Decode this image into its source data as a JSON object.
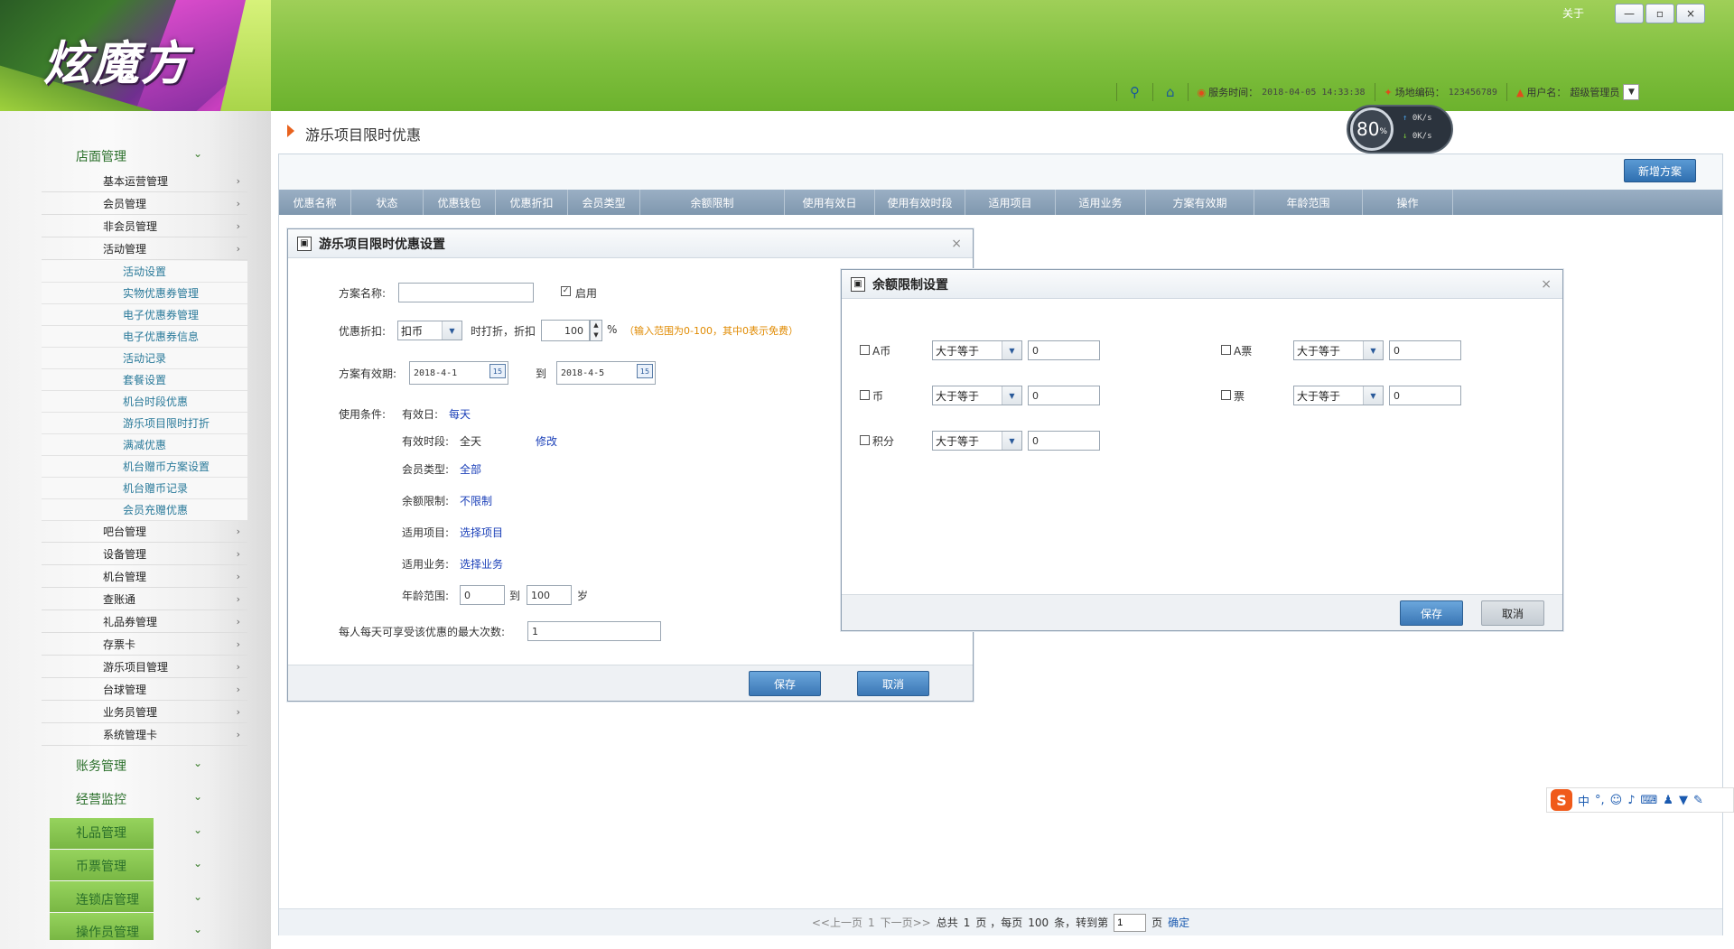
{
  "app": {
    "logo_text": "炫魔方",
    "about": "关于",
    "window_buttons": [
      "—",
      "▫",
      "×"
    ]
  },
  "topbar": {
    "service_time_label": "服务时间：",
    "service_time": "2018-04-05 14:33:38",
    "site_code_label": "场地编码：",
    "site_code": "123456789",
    "username_label": "用户名：",
    "username": "超级管理员"
  },
  "gauge": {
    "value": "80",
    "unit": "%",
    "up": "0K/s",
    "down": "0K/s"
  },
  "sidebar": {
    "groups": [
      {
        "label": "店面管理"
      },
      {
        "label": "账务管理"
      },
      {
        "label": "经营监控"
      },
      {
        "label": "礼品管理"
      },
      {
        "label": "币票管理"
      },
      {
        "label": "连锁店管理"
      },
      {
        "label": "操作员管理"
      }
    ],
    "items_top": [
      "基本运营管理",
      "会员管理",
      "非会员管理",
      "活动管理"
    ],
    "activity_items": [
      "活动设置",
      "实物优惠券管理",
      "电子优惠券管理",
      "电子优惠券信息",
      "活动记录",
      "套餐设置",
      "机台时段优惠",
      "游乐项目限时打折",
      "满减优惠",
      "机台赠币方案设置",
      "机台赠币记录",
      "会员充赠优惠"
    ],
    "items_bottom": [
      "吧台管理",
      "设备管理",
      "机台管理",
      "查账通",
      "礼品券管理",
      "存票卡",
      "游乐项目管理",
      "台球管理",
      "业务员管理",
      "系统管理卡"
    ]
  },
  "page": {
    "title": "游乐项目限时优惠",
    "new_plan_button": "新增方案"
  },
  "table": {
    "headers": [
      "优惠名称",
      "状态",
      "优惠钱包",
      "优惠折扣",
      "会员类型",
      "余额限制",
      "使用有效日",
      "使用有效时段",
      "适用项目",
      "适用业务",
      "方案有效期",
      "年龄范围",
      "操作"
    ]
  },
  "pager": {
    "prev": "<<上一页",
    "page": "1",
    "next": "下一页>>",
    "total_prefix": "总共",
    "total_pages": "1",
    "total_suffix": "页 ，每页",
    "per_page": "100",
    "per_page_suffix": "条，转到第",
    "goto_value": "1",
    "goto_suffix": "页",
    "confirm": "确定"
  },
  "dialog1": {
    "title": "游乐项目限时优惠设置",
    "plan_name_label": "方案名称:",
    "plan_name_value": "",
    "enable_label": "启用",
    "discount_label": "优惠折扣:",
    "discount_type": "扣币",
    "discount_mid": "时打折，折扣",
    "discount_value": "100",
    "percent": "%",
    "discount_hint": "（输入范围为0-100，其中0表示免费）",
    "valid_label": "方案有效期:",
    "valid_from": "2018-4-1",
    "valid_to_label": "到",
    "valid_to": "2018-4-5",
    "cal_icon": "15",
    "conditions_label": "使用条件:",
    "valid_day_label": "有效日:",
    "valid_day_value": "每天",
    "valid_time_label": "有效时段:",
    "valid_time_value": "全天",
    "modify_link": "修改",
    "member_type_label": "会员类型:",
    "member_type_value": "全部",
    "balance_label": "余额限制:",
    "balance_value": "不限制",
    "project_label": "适用项目:",
    "project_value": "选择项目",
    "business_label": "适用业务:",
    "business_value": "选择业务",
    "age_label": "年龄范围:",
    "age_from": "0",
    "age_to_label": "到",
    "age_to": "100",
    "age_unit": "岁",
    "max_times_label": "每人每天可享受该优惠的最大次数:",
    "max_times_value": "1",
    "save": "保存",
    "cancel": "取消"
  },
  "dialog2": {
    "title": "余额限制设置",
    "rows": [
      {
        "label": "A币",
        "op": "大于等于",
        "value": "0"
      },
      {
        "label": "A票",
        "op": "大于等于",
        "value": "0"
      },
      {
        "label": "币",
        "op": "大于等于",
        "value": "0"
      },
      {
        "label": "票",
        "op": "大于等于",
        "value": "0"
      },
      {
        "label": "积分",
        "op": "大于等于",
        "value": "0"
      }
    ],
    "save": "保存",
    "cancel": "取消"
  },
  "ime": {
    "logo": "S",
    "lang": "中"
  },
  "colors": {
    "header_green": "#7fbf3e",
    "sidebar_text": "#2a6f2a",
    "primary_button": "#3b77b5",
    "table_header": "#8ca3b8",
    "link": "#1a3fb8",
    "hint": "#e08a00"
  }
}
